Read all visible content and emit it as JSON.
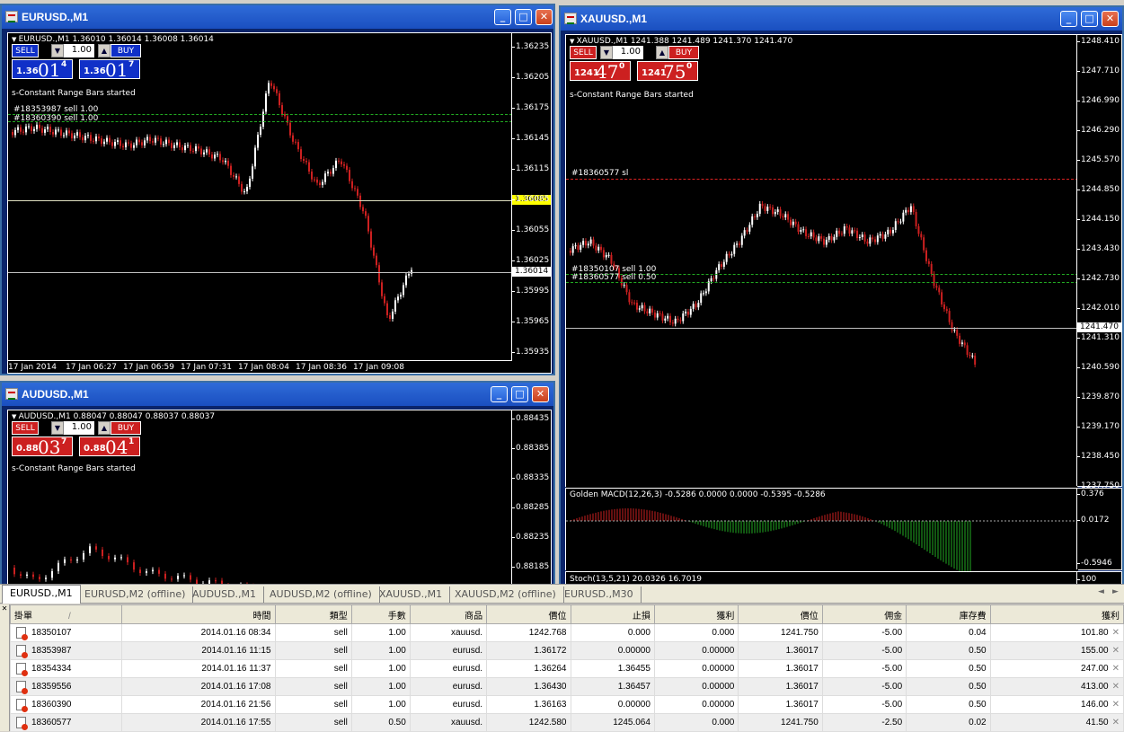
{
  "windows": {
    "eurusd": {
      "title": "EURUSD.,M1",
      "header": "EURUSD.,M1  1.36010 1.36014 1.36008 1.36014",
      "sell": "SELL",
      "buy": "BUY",
      "lots": "1.00",
      "sell_big": "1.36",
      "sell_pp": "01",
      "sell_sup": "4",
      "buy_big": "1.36",
      "buy_pp": "01",
      "buy_sup": "7",
      "status": "s-Constant Range Bars started",
      "order1": "#18353987 sell 1.00",
      "order2": "#18360390 sell 1.00",
      "price_axis": [
        "1.36235",
        "1.36205",
        "1.36175",
        "1.36145",
        "1.36115",
        "1.36085",
        "1.36055",
        "1.36025",
        "1.35995",
        "1.35965",
        "1.35935"
      ],
      "current_bid": "1.36014",
      "marker_price": "1.36085",
      "time_axis": [
        "17 Jan 2014",
        "17 Jan 06:27",
        "17 Jan 06:59",
        "17 Jan 07:31",
        "17 Jan 08:04",
        "17 Jan 08:36",
        "17 Jan 09:08"
      ]
    },
    "audusd": {
      "title": "AUDUSD.,M1",
      "header": "AUDUSD.,M1  0.88047 0.88047 0.88037 0.88037",
      "sell": "SELL",
      "buy": "BUY",
      "lots": "1.00",
      "sell_big": "0.88",
      "sell_pp": "03",
      "sell_sup": "7",
      "buy_big": "0.88",
      "buy_pp": "04",
      "buy_sup": "1",
      "status": "s-Constant Range Bars started",
      "price_axis": [
        "0.88435",
        "0.88385",
        "0.88335",
        "0.88285",
        "0.88235",
        "0.88185"
      ]
    },
    "xauusd": {
      "title": "XAUUSD.,M1",
      "header": "XAUUSD.,M1  1241.388 1241.489 1241.370 1241.470",
      "sell": "SELL",
      "buy": "BUY",
      "lots": "1.00",
      "sell_big": "1241",
      "sell_pp": "47",
      "sell_sup": "0",
      "buy_big": "1241",
      "buy_pp": "75",
      "buy_sup": "0",
      "status": "s-Constant Range Bars started",
      "sl_label": "#18360577 sl",
      "order1": "#18350107 sell 1.00",
      "order2": "#18360577 sell 0.50",
      "price_axis": [
        "1248.410",
        "1247.710",
        "1246.990",
        "1246.290",
        "1245.570",
        "1244.850",
        "1244.150",
        "1243.430",
        "1242.730",
        "1242.010",
        "1241.310",
        "1240.590",
        "1239.870",
        "1239.170",
        "1238.450",
        "1237.750"
      ],
      "current_bid": "1241.470",
      "macd_label": "Golden MACD(12,26,3) -0.5286 0.0000 0.0000 -0.5395 -0.5286",
      "macd_top": "0.376",
      "macd_mid": "0.0172",
      "macd_bot": "-0.5946",
      "stoch_label": "Stoch(13,5,21) 20.0326 16.7019",
      "stoch_top": "100"
    }
  },
  "tabs": [
    "EURUSD.,M1",
    "EURUSD,M2 (offline)",
    "AUDUSD.,M1",
    "AUDUSD,M2 (offline)",
    "XAUUSD.,M1",
    "XAUUSD,M2 (offline)",
    "EURUSD.,M30"
  ],
  "table": {
    "columns": [
      "掛單",
      "時間",
      "類型",
      "手數",
      "商品",
      "價位",
      "止損",
      "獲利",
      "價位",
      "佣金",
      "庫存費",
      "獲利"
    ],
    "sort_marker": "/",
    "rows": [
      [
        "18350107",
        "2014.01.16 08:34",
        "sell",
        "1.00",
        "xauusd.",
        "1242.768",
        "0.000",
        "0.000",
        "1241.750",
        "-5.00",
        "0.04",
        "101.80"
      ],
      [
        "18353987",
        "2014.01.16 11:15",
        "sell",
        "1.00",
        "eurusd.",
        "1.36172",
        "0.00000",
        "0.00000",
        "1.36017",
        "-5.00",
        "0.50",
        "155.00"
      ],
      [
        "18354334",
        "2014.01.16 11:37",
        "sell",
        "1.00",
        "eurusd.",
        "1.36264",
        "1.36455",
        "0.00000",
        "1.36017",
        "-5.00",
        "0.50",
        "247.00"
      ],
      [
        "18359556",
        "2014.01.16 17:08",
        "sell",
        "1.00",
        "eurusd.",
        "1.36430",
        "1.36457",
        "0.00000",
        "1.36017",
        "-5.00",
        "0.50",
        "413.00"
      ],
      [
        "18360390",
        "2014.01.16 21:56",
        "sell",
        "1.00",
        "eurusd.",
        "1.36163",
        "0.00000",
        "0.00000",
        "1.36017",
        "-5.00",
        "0.50",
        "146.00"
      ],
      [
        "18360577",
        "2014.01.16 17:55",
        "sell",
        "0.50",
        "xauusd.",
        "1242.580",
        "1245.064",
        "0.000",
        "1241.750",
        "-2.50",
        "0.02",
        "41.50"
      ]
    ]
  },
  "colors": {
    "bull": "#ffffff",
    "bear": "#cc2020",
    "order_line": "#22aa22",
    "sl_line": "#dd2222",
    "sell_btn": "#cc2020",
    "buy_btn": "#cc2020",
    "eur_btn": "#1030c8"
  }
}
